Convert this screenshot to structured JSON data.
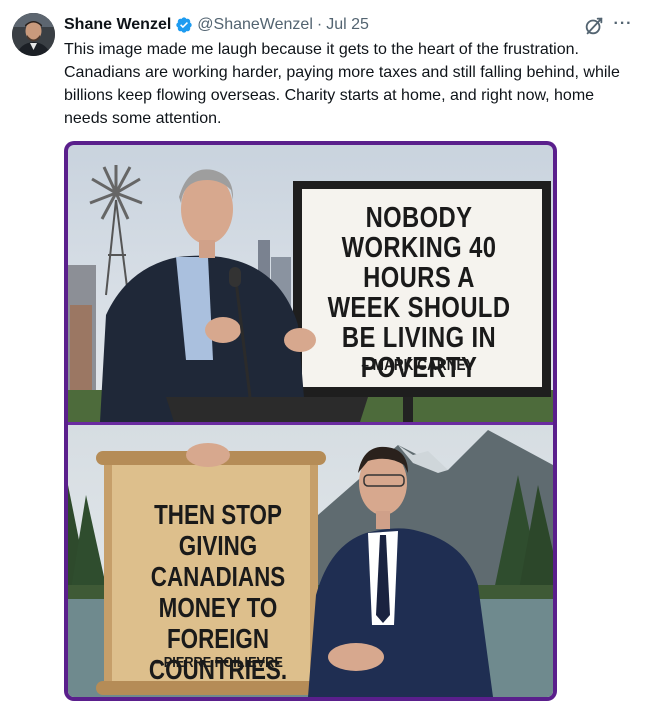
{
  "tweet": {
    "author_name": "Shane Wenzel",
    "author_handle": "@ShaneWenzel",
    "separator": "·",
    "timestamp": "Jul 25",
    "text": "This image made me laugh because it gets to the heart of the frustration. Canadians are working harder, paying more taxes and still falling behind, while billions keep flowing overseas. Charity starts at home, and right now, home needs some attention.",
    "icons": {
      "verified": "verified-badge-icon",
      "grok": "grok-icon",
      "more": "more-options-icon"
    },
    "more_label": "···"
  },
  "media": {
    "top_sign": {
      "text": "NOBODY WORKING 40 HOURS A WEEK SHOULD BE LIVING IN POVERTY",
      "attribution": "– MARK CARNEY"
    },
    "bottom_sign": {
      "text": "THEN STOP GIVING CANADIANS MONEY TO FOREIGN COUNTRIES.",
      "attribution": "– PIERRE POILIEVRE"
    }
  },
  "colors": {
    "verified_blue": "#1d9bf0",
    "secondary_text": "#536471",
    "media_border": "#5a1f8c"
  }
}
